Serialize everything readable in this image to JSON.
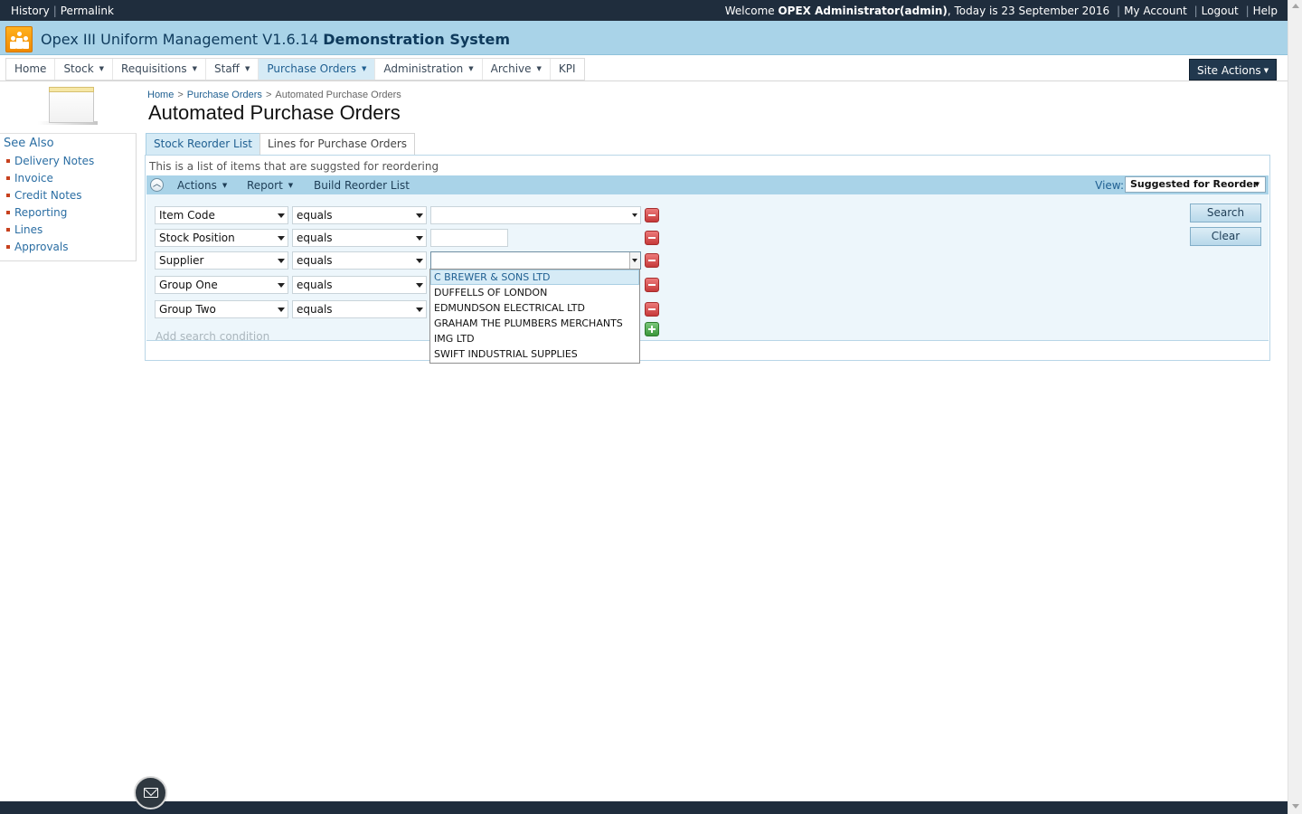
{
  "topbar": {
    "history": "History",
    "permalink": "Permalink",
    "welcome_prefix": "Welcome",
    "user": "OPEX Administrator(admin)",
    "date_text": ", Today is 23 September 2016",
    "my_account": "My Account",
    "logout": "Logout",
    "help": "Help"
  },
  "header": {
    "app_name": "Opex III Uniform Management V1.6.14",
    "system": "Demonstration System"
  },
  "nav": {
    "items": [
      {
        "label": "Home"
      },
      {
        "label": "Stock"
      },
      {
        "label": "Requisitions"
      },
      {
        "label": "Staff"
      },
      {
        "label": "Purchase Orders"
      },
      {
        "label": "Administration"
      },
      {
        "label": "Archive"
      },
      {
        "label": "KPI"
      }
    ],
    "site_actions": "Site Actions"
  },
  "see_also": {
    "title": "See Also",
    "items": [
      "Delivery Notes",
      "Invoice",
      "Credit Notes",
      "Reporting",
      "Lines",
      "Approvals"
    ]
  },
  "breadcrumb": {
    "home": "Home",
    "section": "Purchase Orders",
    "current": "Automated Purchase Orders"
  },
  "page": {
    "title": "Automated Purchase Orders",
    "tabs": [
      "Stock Reorder List",
      "Lines for Purchase Orders"
    ],
    "description": "This is a list of items that are suggsted for reordering"
  },
  "toolbar": {
    "actions": "Actions",
    "report": "Report",
    "build": "Build Reorder List",
    "view_label": "View:",
    "view_value": "Suggested for Reorder"
  },
  "search": {
    "conditions": [
      {
        "field": "Item Code",
        "operator": "equals",
        "value": ""
      },
      {
        "field": "Stock Position",
        "operator": "equals",
        "value": ""
      },
      {
        "field": "Supplier",
        "operator": "equals",
        "value": ""
      },
      {
        "field": "Group One",
        "operator": "equals"
      },
      {
        "field": "Group Two",
        "operator": "equals"
      }
    ],
    "add_condition": "Add search condition",
    "search_button": "Search",
    "clear_button": "Clear"
  },
  "supplier_options": [
    "C BREWER & SONS LTD",
    "DUFFELLS OF LONDON",
    "EDMUNDSON ELECTRICAL LTD",
    "GRAHAM THE PLUMBERS MERCHANTS",
    "IMG LTD",
    "SWIFT INDUSTRIAL SUPPLIES"
  ]
}
